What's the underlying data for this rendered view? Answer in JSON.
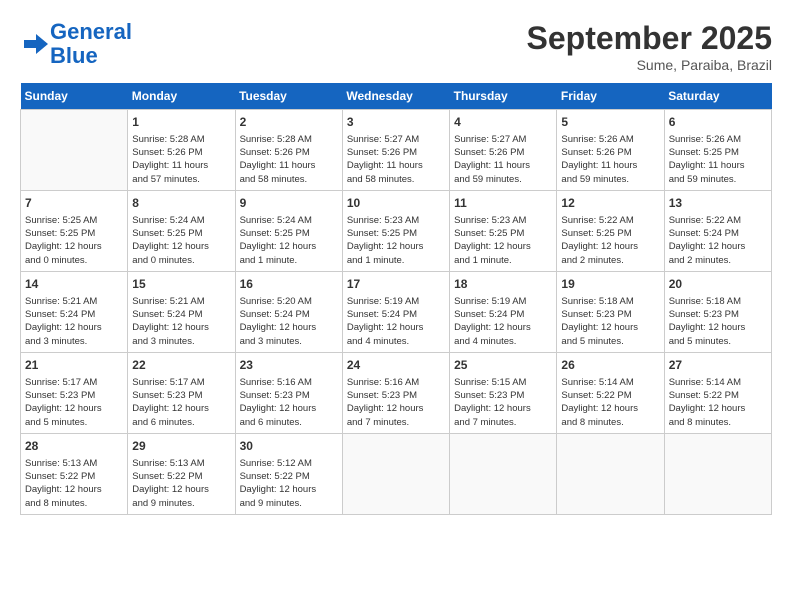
{
  "header": {
    "logo_line1": "General",
    "logo_line2": "Blue",
    "month": "September 2025",
    "location": "Sume, Paraiba, Brazil"
  },
  "weekdays": [
    "Sunday",
    "Monday",
    "Tuesday",
    "Wednesday",
    "Thursday",
    "Friday",
    "Saturday"
  ],
  "weeks": [
    [
      {
        "day": "",
        "info": ""
      },
      {
        "day": "1",
        "info": "Sunrise: 5:28 AM\nSunset: 5:26 PM\nDaylight: 11 hours\nand 57 minutes."
      },
      {
        "day": "2",
        "info": "Sunrise: 5:28 AM\nSunset: 5:26 PM\nDaylight: 11 hours\nand 58 minutes."
      },
      {
        "day": "3",
        "info": "Sunrise: 5:27 AM\nSunset: 5:26 PM\nDaylight: 11 hours\nand 58 minutes."
      },
      {
        "day": "4",
        "info": "Sunrise: 5:27 AM\nSunset: 5:26 PM\nDaylight: 11 hours\nand 59 minutes."
      },
      {
        "day": "5",
        "info": "Sunrise: 5:26 AM\nSunset: 5:26 PM\nDaylight: 11 hours\nand 59 minutes."
      },
      {
        "day": "6",
        "info": "Sunrise: 5:26 AM\nSunset: 5:25 PM\nDaylight: 11 hours\nand 59 minutes."
      }
    ],
    [
      {
        "day": "7",
        "info": "Sunrise: 5:25 AM\nSunset: 5:25 PM\nDaylight: 12 hours\nand 0 minutes."
      },
      {
        "day": "8",
        "info": "Sunrise: 5:24 AM\nSunset: 5:25 PM\nDaylight: 12 hours\nand 0 minutes."
      },
      {
        "day": "9",
        "info": "Sunrise: 5:24 AM\nSunset: 5:25 PM\nDaylight: 12 hours\nand 1 minute."
      },
      {
        "day": "10",
        "info": "Sunrise: 5:23 AM\nSunset: 5:25 PM\nDaylight: 12 hours\nand 1 minute."
      },
      {
        "day": "11",
        "info": "Sunrise: 5:23 AM\nSunset: 5:25 PM\nDaylight: 12 hours\nand 1 minute."
      },
      {
        "day": "12",
        "info": "Sunrise: 5:22 AM\nSunset: 5:25 PM\nDaylight: 12 hours\nand 2 minutes."
      },
      {
        "day": "13",
        "info": "Sunrise: 5:22 AM\nSunset: 5:24 PM\nDaylight: 12 hours\nand 2 minutes."
      }
    ],
    [
      {
        "day": "14",
        "info": "Sunrise: 5:21 AM\nSunset: 5:24 PM\nDaylight: 12 hours\nand 3 minutes."
      },
      {
        "day": "15",
        "info": "Sunrise: 5:21 AM\nSunset: 5:24 PM\nDaylight: 12 hours\nand 3 minutes."
      },
      {
        "day": "16",
        "info": "Sunrise: 5:20 AM\nSunset: 5:24 PM\nDaylight: 12 hours\nand 3 minutes."
      },
      {
        "day": "17",
        "info": "Sunrise: 5:19 AM\nSunset: 5:24 PM\nDaylight: 12 hours\nand 4 minutes."
      },
      {
        "day": "18",
        "info": "Sunrise: 5:19 AM\nSunset: 5:24 PM\nDaylight: 12 hours\nand 4 minutes."
      },
      {
        "day": "19",
        "info": "Sunrise: 5:18 AM\nSunset: 5:23 PM\nDaylight: 12 hours\nand 5 minutes."
      },
      {
        "day": "20",
        "info": "Sunrise: 5:18 AM\nSunset: 5:23 PM\nDaylight: 12 hours\nand 5 minutes."
      }
    ],
    [
      {
        "day": "21",
        "info": "Sunrise: 5:17 AM\nSunset: 5:23 PM\nDaylight: 12 hours\nand 5 minutes."
      },
      {
        "day": "22",
        "info": "Sunrise: 5:17 AM\nSunset: 5:23 PM\nDaylight: 12 hours\nand 6 minutes."
      },
      {
        "day": "23",
        "info": "Sunrise: 5:16 AM\nSunset: 5:23 PM\nDaylight: 12 hours\nand 6 minutes."
      },
      {
        "day": "24",
        "info": "Sunrise: 5:16 AM\nSunset: 5:23 PM\nDaylight: 12 hours\nand 7 minutes."
      },
      {
        "day": "25",
        "info": "Sunrise: 5:15 AM\nSunset: 5:23 PM\nDaylight: 12 hours\nand 7 minutes."
      },
      {
        "day": "26",
        "info": "Sunrise: 5:14 AM\nSunset: 5:22 PM\nDaylight: 12 hours\nand 8 minutes."
      },
      {
        "day": "27",
        "info": "Sunrise: 5:14 AM\nSunset: 5:22 PM\nDaylight: 12 hours\nand 8 minutes."
      }
    ],
    [
      {
        "day": "28",
        "info": "Sunrise: 5:13 AM\nSunset: 5:22 PM\nDaylight: 12 hours\nand 8 minutes."
      },
      {
        "day": "29",
        "info": "Sunrise: 5:13 AM\nSunset: 5:22 PM\nDaylight: 12 hours\nand 9 minutes."
      },
      {
        "day": "30",
        "info": "Sunrise: 5:12 AM\nSunset: 5:22 PM\nDaylight: 12 hours\nand 9 minutes."
      },
      {
        "day": "",
        "info": ""
      },
      {
        "day": "",
        "info": ""
      },
      {
        "day": "",
        "info": ""
      },
      {
        "day": "",
        "info": ""
      }
    ]
  ]
}
